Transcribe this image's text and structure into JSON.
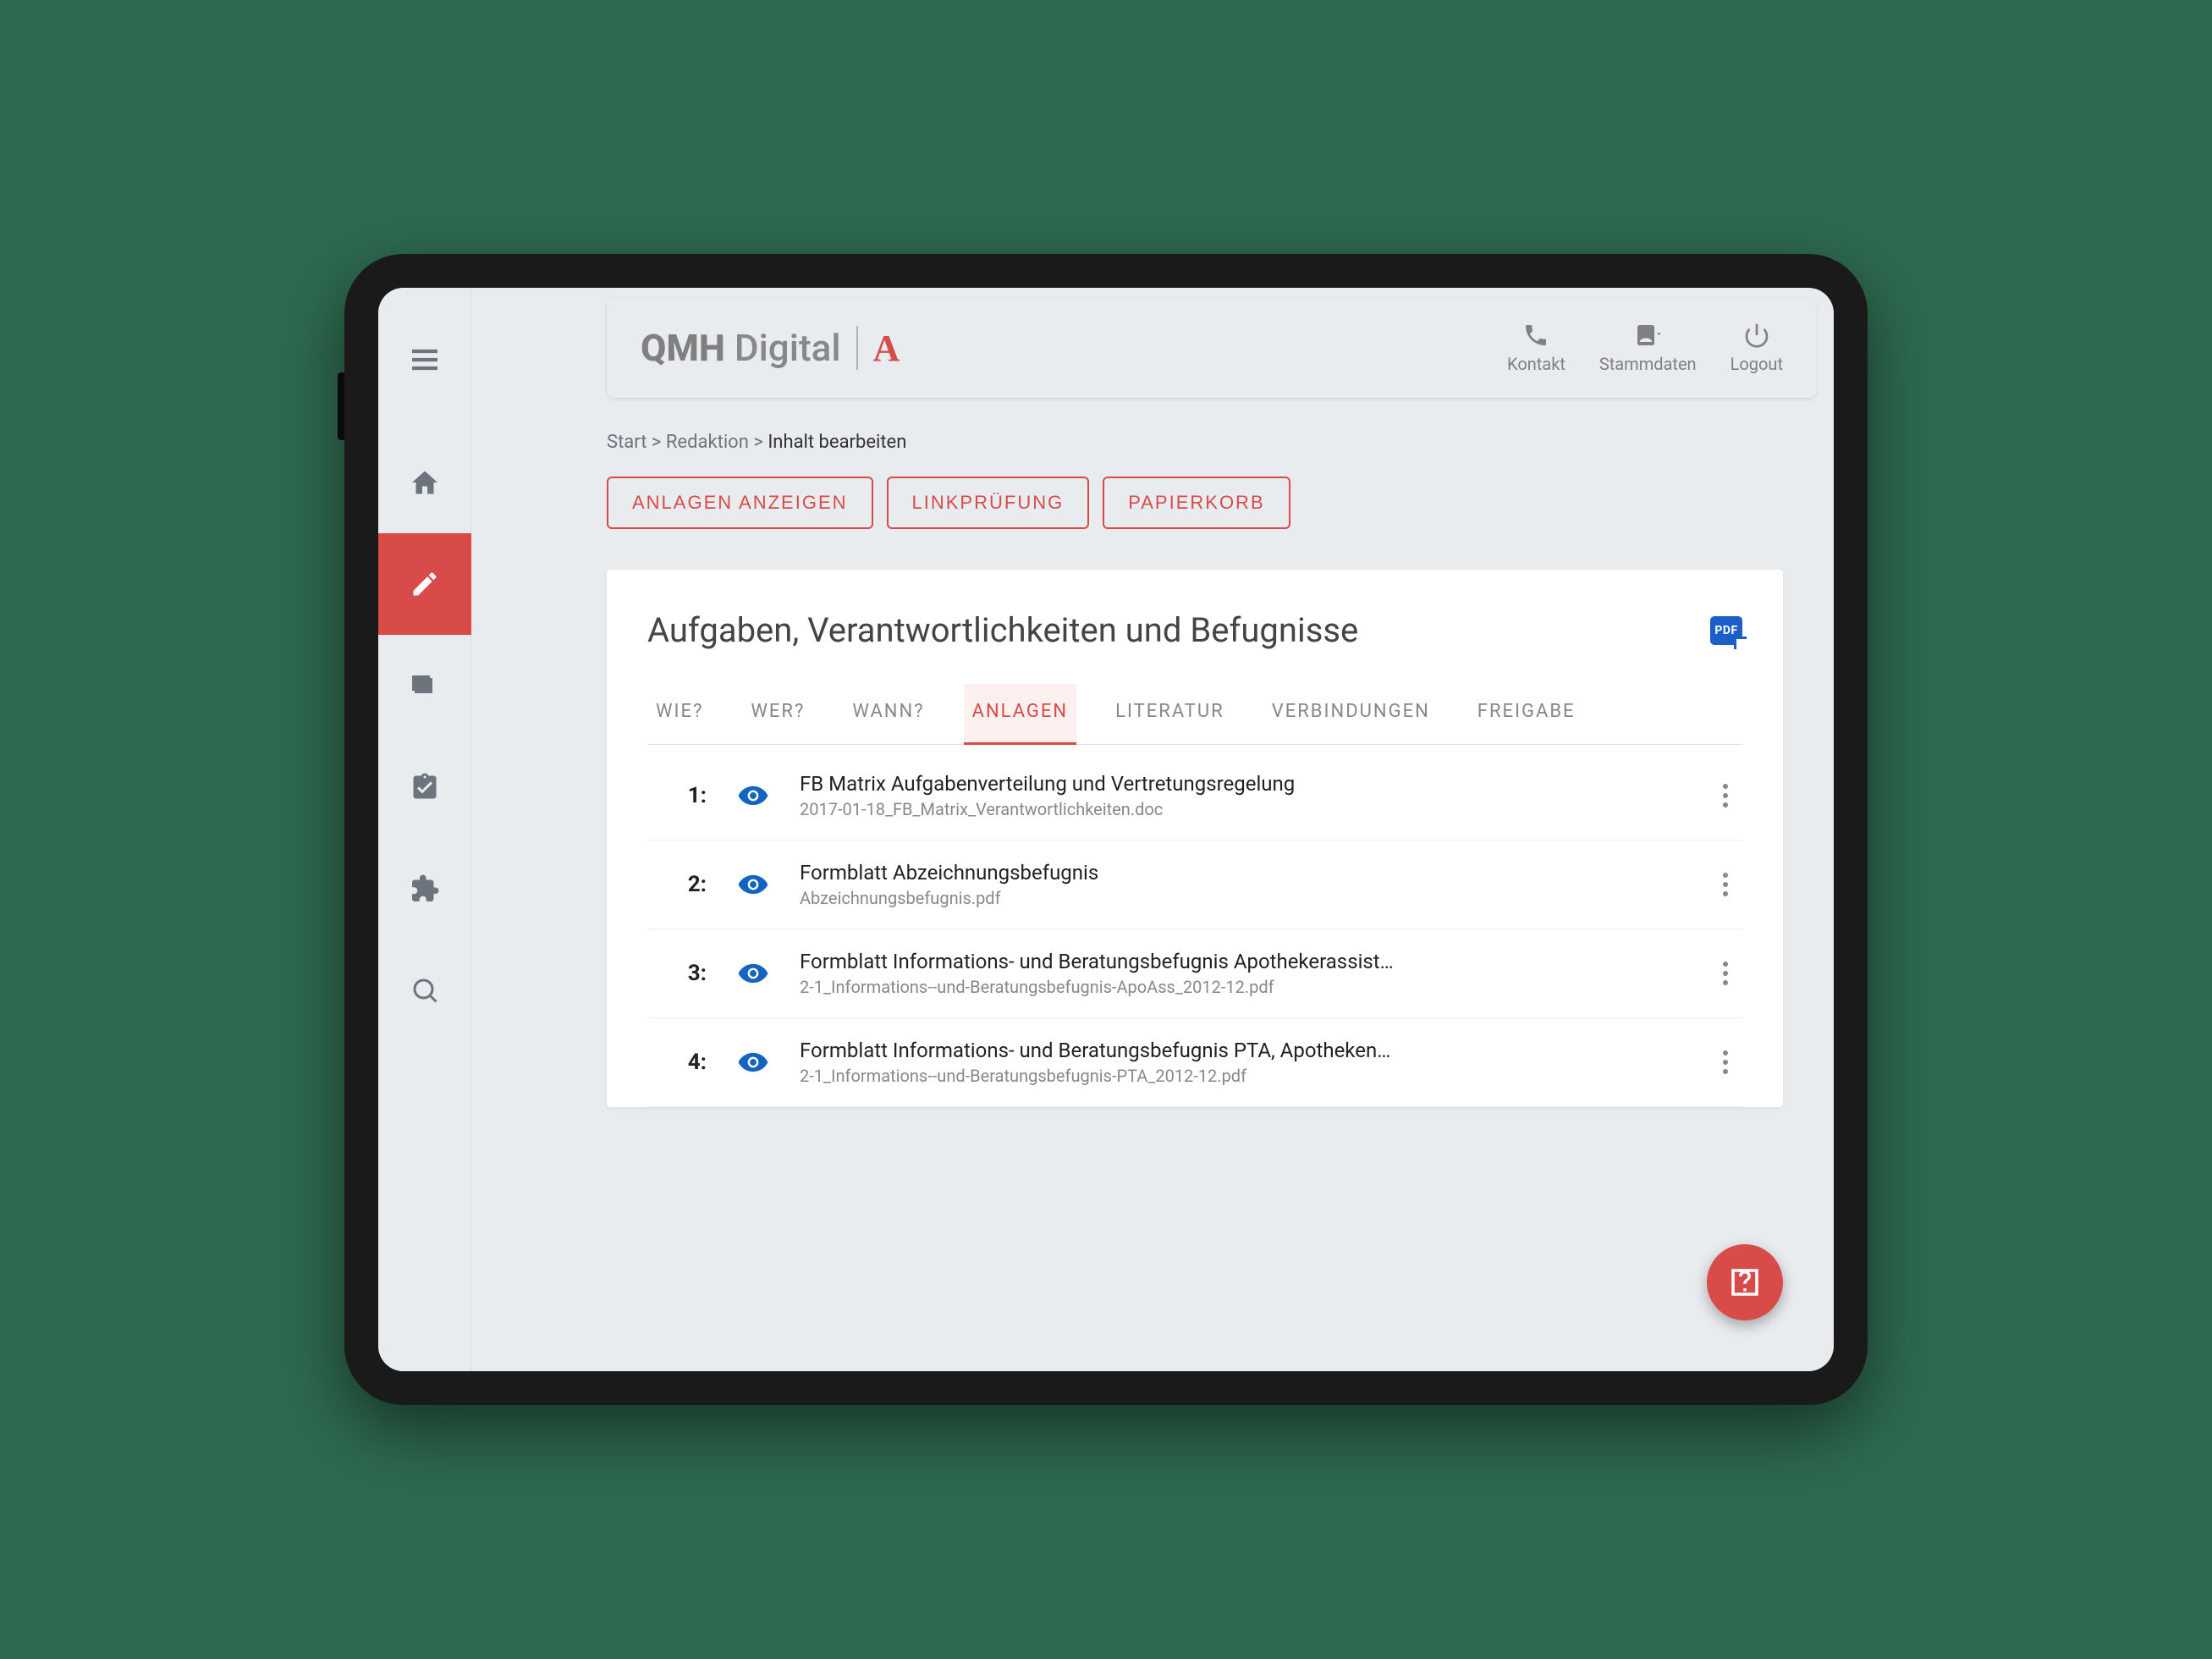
{
  "brand": {
    "bold": "QMH",
    "light": "Digital",
    "glyph": "A"
  },
  "header": {
    "contact": "Kontakt",
    "master_data": "Stammdaten",
    "logout": "Logout"
  },
  "breadcrumb": {
    "start": "Start",
    "mid": "Redaktion",
    "current": "Inhalt bearbeiten",
    "sep": ">"
  },
  "actions": {
    "show_attachments": "ANLAGEN ANZEIGEN",
    "link_check": "LINKPRÜFUNG",
    "trash": "PAPIERKORB"
  },
  "card": {
    "title": "Aufgaben, Verantwortlichkeiten und Befugnisse",
    "pdf_label": "PDF"
  },
  "tabs": {
    "wie": "WIE?",
    "wer": "WER?",
    "wann": "WANN?",
    "anlagen": "ANLAGEN",
    "literatur": "LITERATUR",
    "verbindungen": "VERBINDUNGEN",
    "freigabe": "FREIGABE"
  },
  "rows": [
    {
      "idx": "1:",
      "title": "FB Matrix Aufgabenverteilung und Vertretungsregelung",
      "file": "2017-01-18_FB_Matrix_Verantwortlichkeiten.doc"
    },
    {
      "idx": "2:",
      "title": "Formblatt Abzeichnungsbefugnis",
      "file": "Abzeichnungsbefugnis.pdf"
    },
    {
      "idx": "3:",
      "title": "Formblatt Informations- und Beratungsbefugnis Apothekerassist…",
      "file": "2-1_Informations--und-Beratungsbefugnis-ApoAss_2012-12.pdf"
    },
    {
      "idx": "4:",
      "title": "Formblatt Informations- und Beratungsbefugnis PTA, Apotheken…",
      "file": "2-1_Informations--und-Beratungsbefugnis-PTA_2012-12.pdf"
    }
  ]
}
